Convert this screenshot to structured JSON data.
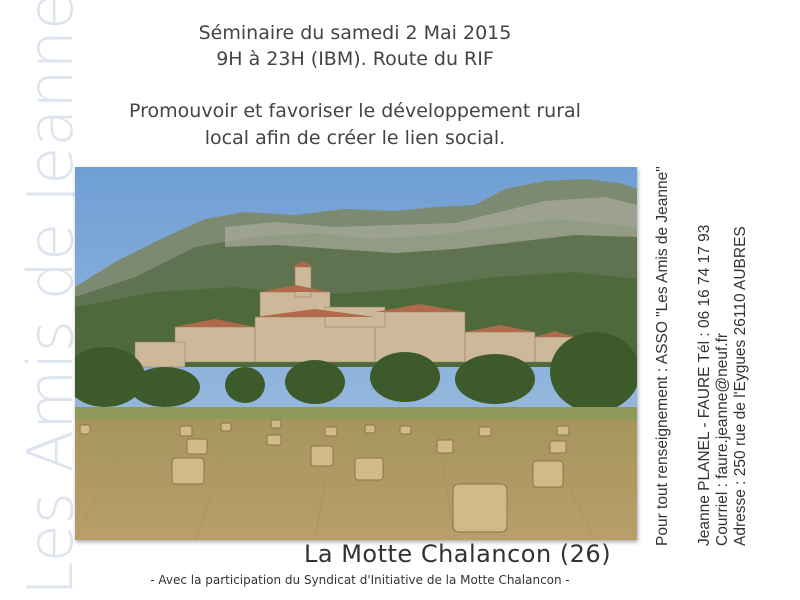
{
  "side_title": "Les Amis de Jeanne",
  "header": {
    "line1": "Séminaire du samedi 2 Mai 2015",
    "line2": "9H à 23H (IBM). Route du RIF",
    "line3": "Promouvoir et favoriser le développement rural",
    "line4": "local afin de créer le lien social."
  },
  "place": "La Motte Chalancon (26)",
  "participation": "- Avec la participation du Syndicat d'Initiative de la Motte Chalancon -",
  "contact": {
    "info": "Pour tout renseignement :   ASSO \"Les Amis de Jeanne\"",
    "person": "Jeanne  PLANEL - FAURE    Tél : 06 16 74 17 93",
    "email": "Courriel :  faure.jeanne@neuf.fr",
    "address": "Adresse : 250 rue de l'Eygues 26110 AUBRES"
  },
  "colors": {
    "side_title": "#dde4ef",
    "text": "#444444",
    "sky": "#7fa8d6",
    "field": "#b8a064"
  }
}
